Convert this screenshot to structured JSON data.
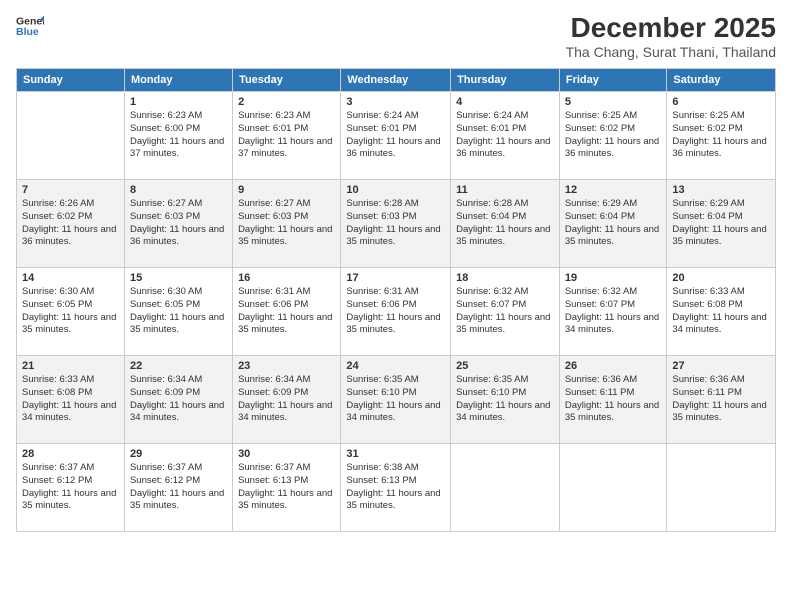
{
  "logo": {
    "line1": "General",
    "line2": "Blue"
  },
  "title": "December 2025",
  "subtitle": "Tha Chang, Surat Thani, Thailand",
  "days_of_week": [
    "Sunday",
    "Monday",
    "Tuesday",
    "Wednesday",
    "Thursday",
    "Friday",
    "Saturday"
  ],
  "weeks": [
    [
      {
        "day": "",
        "info": ""
      },
      {
        "day": "1",
        "info": "Sunrise: 6:23 AM\nSunset: 6:00 PM\nDaylight: 11 hours\nand 37 minutes."
      },
      {
        "day": "2",
        "info": "Sunrise: 6:23 AM\nSunset: 6:01 PM\nDaylight: 11 hours\nand 37 minutes."
      },
      {
        "day": "3",
        "info": "Sunrise: 6:24 AM\nSunset: 6:01 PM\nDaylight: 11 hours\nand 36 minutes."
      },
      {
        "day": "4",
        "info": "Sunrise: 6:24 AM\nSunset: 6:01 PM\nDaylight: 11 hours\nand 36 minutes."
      },
      {
        "day": "5",
        "info": "Sunrise: 6:25 AM\nSunset: 6:02 PM\nDaylight: 11 hours\nand 36 minutes."
      },
      {
        "day": "6",
        "info": "Sunrise: 6:25 AM\nSunset: 6:02 PM\nDaylight: 11 hours\nand 36 minutes."
      }
    ],
    [
      {
        "day": "7",
        "info": "Sunrise: 6:26 AM\nSunset: 6:02 PM\nDaylight: 11 hours\nand 36 minutes."
      },
      {
        "day": "8",
        "info": "Sunrise: 6:27 AM\nSunset: 6:03 PM\nDaylight: 11 hours\nand 36 minutes."
      },
      {
        "day": "9",
        "info": "Sunrise: 6:27 AM\nSunset: 6:03 PM\nDaylight: 11 hours\nand 35 minutes."
      },
      {
        "day": "10",
        "info": "Sunrise: 6:28 AM\nSunset: 6:03 PM\nDaylight: 11 hours\nand 35 minutes."
      },
      {
        "day": "11",
        "info": "Sunrise: 6:28 AM\nSunset: 6:04 PM\nDaylight: 11 hours\nand 35 minutes."
      },
      {
        "day": "12",
        "info": "Sunrise: 6:29 AM\nSunset: 6:04 PM\nDaylight: 11 hours\nand 35 minutes."
      },
      {
        "day": "13",
        "info": "Sunrise: 6:29 AM\nSunset: 6:04 PM\nDaylight: 11 hours\nand 35 minutes."
      }
    ],
    [
      {
        "day": "14",
        "info": "Sunrise: 6:30 AM\nSunset: 6:05 PM\nDaylight: 11 hours\nand 35 minutes."
      },
      {
        "day": "15",
        "info": "Sunrise: 6:30 AM\nSunset: 6:05 PM\nDaylight: 11 hours\nand 35 minutes."
      },
      {
        "day": "16",
        "info": "Sunrise: 6:31 AM\nSunset: 6:06 PM\nDaylight: 11 hours\nand 35 minutes."
      },
      {
        "day": "17",
        "info": "Sunrise: 6:31 AM\nSunset: 6:06 PM\nDaylight: 11 hours\nand 35 minutes."
      },
      {
        "day": "18",
        "info": "Sunrise: 6:32 AM\nSunset: 6:07 PM\nDaylight: 11 hours\nand 35 minutes."
      },
      {
        "day": "19",
        "info": "Sunrise: 6:32 AM\nSunset: 6:07 PM\nDaylight: 11 hours\nand 34 minutes."
      },
      {
        "day": "20",
        "info": "Sunrise: 6:33 AM\nSunset: 6:08 PM\nDaylight: 11 hours\nand 34 minutes."
      }
    ],
    [
      {
        "day": "21",
        "info": "Sunrise: 6:33 AM\nSunset: 6:08 PM\nDaylight: 11 hours\nand 34 minutes."
      },
      {
        "day": "22",
        "info": "Sunrise: 6:34 AM\nSunset: 6:09 PM\nDaylight: 11 hours\nand 34 minutes."
      },
      {
        "day": "23",
        "info": "Sunrise: 6:34 AM\nSunset: 6:09 PM\nDaylight: 11 hours\nand 34 minutes."
      },
      {
        "day": "24",
        "info": "Sunrise: 6:35 AM\nSunset: 6:10 PM\nDaylight: 11 hours\nand 34 minutes."
      },
      {
        "day": "25",
        "info": "Sunrise: 6:35 AM\nSunset: 6:10 PM\nDaylight: 11 hours\nand 34 minutes."
      },
      {
        "day": "26",
        "info": "Sunrise: 6:36 AM\nSunset: 6:11 PM\nDaylight: 11 hours\nand 35 minutes."
      },
      {
        "day": "27",
        "info": "Sunrise: 6:36 AM\nSunset: 6:11 PM\nDaylight: 11 hours\nand 35 minutes."
      }
    ],
    [
      {
        "day": "28",
        "info": "Sunrise: 6:37 AM\nSunset: 6:12 PM\nDaylight: 11 hours\nand 35 minutes."
      },
      {
        "day": "29",
        "info": "Sunrise: 6:37 AM\nSunset: 6:12 PM\nDaylight: 11 hours\nand 35 minutes."
      },
      {
        "day": "30",
        "info": "Sunrise: 6:37 AM\nSunset: 6:13 PM\nDaylight: 11 hours\nand 35 minutes."
      },
      {
        "day": "31",
        "info": "Sunrise: 6:38 AM\nSunset: 6:13 PM\nDaylight: 11 hours\nand 35 minutes."
      },
      {
        "day": "",
        "info": ""
      },
      {
        "day": "",
        "info": ""
      },
      {
        "day": "",
        "info": ""
      }
    ]
  ]
}
